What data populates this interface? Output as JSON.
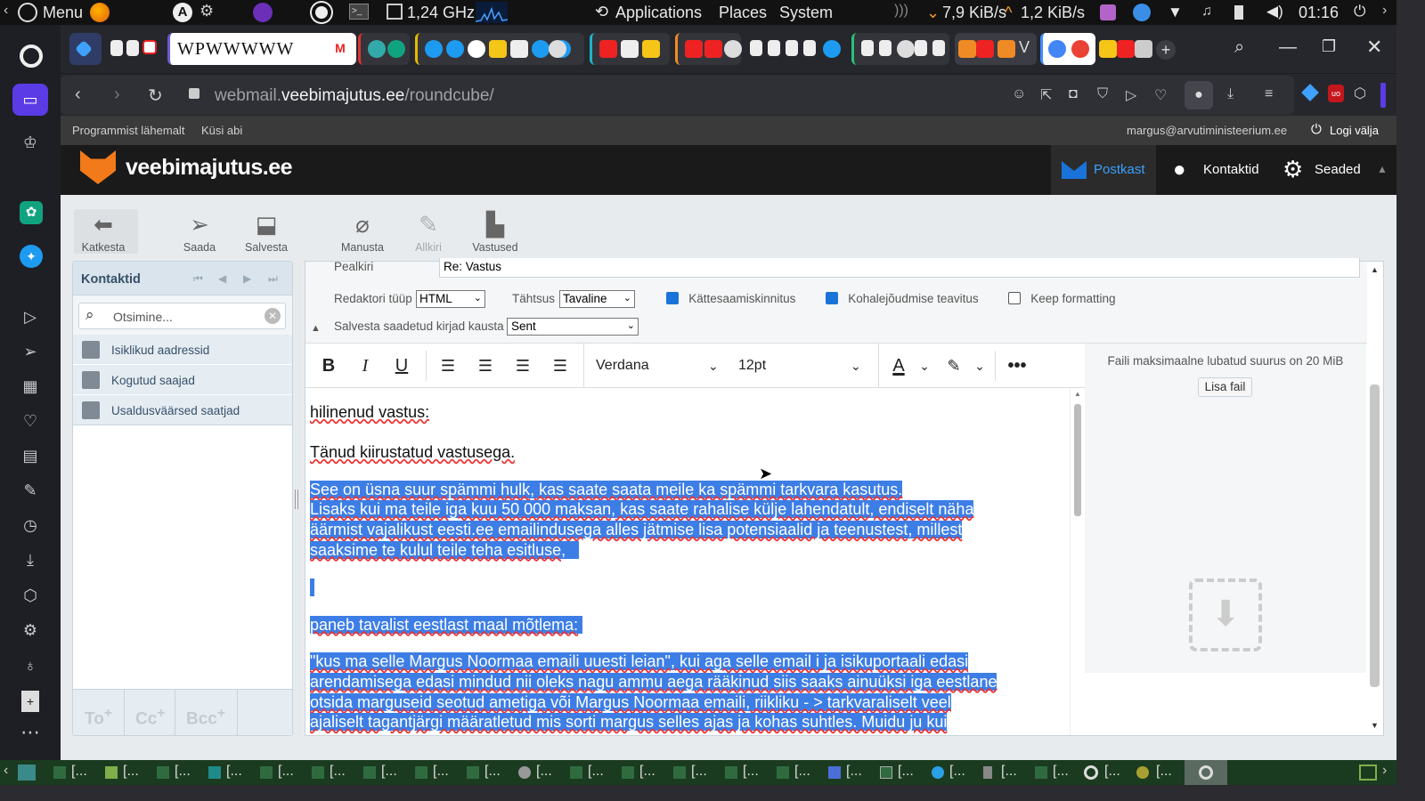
{
  "system_panel": {
    "menu_label": "Menu",
    "cpu_freq": "1,24 GHz",
    "applications": "Applications",
    "places": "Places",
    "system": "System",
    "net_down": "7,9 KiB/s",
    "net_up": "1,2 KiB/s",
    "clock": "01:16"
  },
  "browser": {
    "url_domain_prefix": "webmail.",
    "url_domain": "veebimajutus.ee",
    "url_path": "/roundcube/"
  },
  "webmail": {
    "top_links": [
      "Programmist lähemalt",
      "Küsi abi"
    ],
    "user_email": "margus@arvutiministeerium.ee",
    "logout": "Logi välja",
    "logo": "veebimajutus.ee",
    "nav": {
      "mail": "Postkast",
      "contacts": "Kontaktid",
      "settings": "Seaded"
    },
    "toolbar": {
      "cancel": "Katkesta",
      "send": "Saada",
      "save": "Salvesta",
      "attach": "Manusta",
      "signature": "Allkiri",
      "responses": "Vastused"
    },
    "contacts_panel": {
      "title": "Kontaktid",
      "search_placeholder": "Otsimine...",
      "groups": [
        "Isiklikud aadressid",
        "Kogutud saajad",
        "Usaldusväärsed saatjad"
      ],
      "bottom_buttons": [
        "To",
        "Cc",
        "Bcc"
      ]
    },
    "compose": {
      "subject_label": "Pealkiri",
      "subject_value": "Re: Vastus",
      "editor_type_label": "Redaktori tüüp",
      "editor_type_value": "HTML",
      "priority_label": "Tähtsus",
      "priority_value": "Tavaline",
      "return_receipt_label": "Kättesaamiskinnitus",
      "return_receipt_checked": true,
      "dsn_label": "Kohalejõudmise teavitus",
      "dsn_checked": true,
      "keep_formatting_label": "Keep formatting",
      "keep_formatting_checked": false,
      "save_sent_label": "Salvesta saadetud kirjad kausta",
      "save_sent_value": "Sent",
      "font_family": "Verdana",
      "font_size": "12pt",
      "attach_info": "Faili maksimaalne lubatud suurus on 20 MiB",
      "add_file": "Lisa fail"
    },
    "body": {
      "line1": "hilinenud vastus:",
      "line2": "Tänud kiirustatud vastusega.",
      "sel1": "See on üsna suur spämmi hulk, kas saate saata meile ka spämmi tarkvara kasutus.",
      "sel2": "Lisaks kui ma teile iga kuu 50 000 maksan, kas saate rahalise külje lahendatult, endiselt näha",
      "sel3": "äärmist vajalikust eesti.ee emailindusega alles jätmise lisa potensiaalid ja teenustest, millest",
      "sel4": "saaksime te kulul teile teha esitluse,",
      "sel5": " paneb tavalist eestlast maal mõtlema:",
      "sel6": "\"kus ma selle Margus Noormaa emaili uuesti leian\", kui aga selle email i ja isikuportaali edasi",
      "sel7": "arendamisega edasi mindud nii oleks nagu ammu aega rääkinud siis saaks ainuüksi iga eestlane",
      "sel8": "otsida marguseid seotud ametiga või Margus Noormaa emaili, riikliku - > tarkvaraliselt veel",
      "sel9": "ajaliselt tagantjärgi määratletud mis sorti margus selles ajas ja kohas suhtles. Muidu ju kui"
    }
  },
  "colors": {
    "selection": "#3d7ee6",
    "brand_blue": "#1a73d9",
    "header_bg": "#1a1a1a",
    "taskbar_bg": "#1b3b20"
  }
}
